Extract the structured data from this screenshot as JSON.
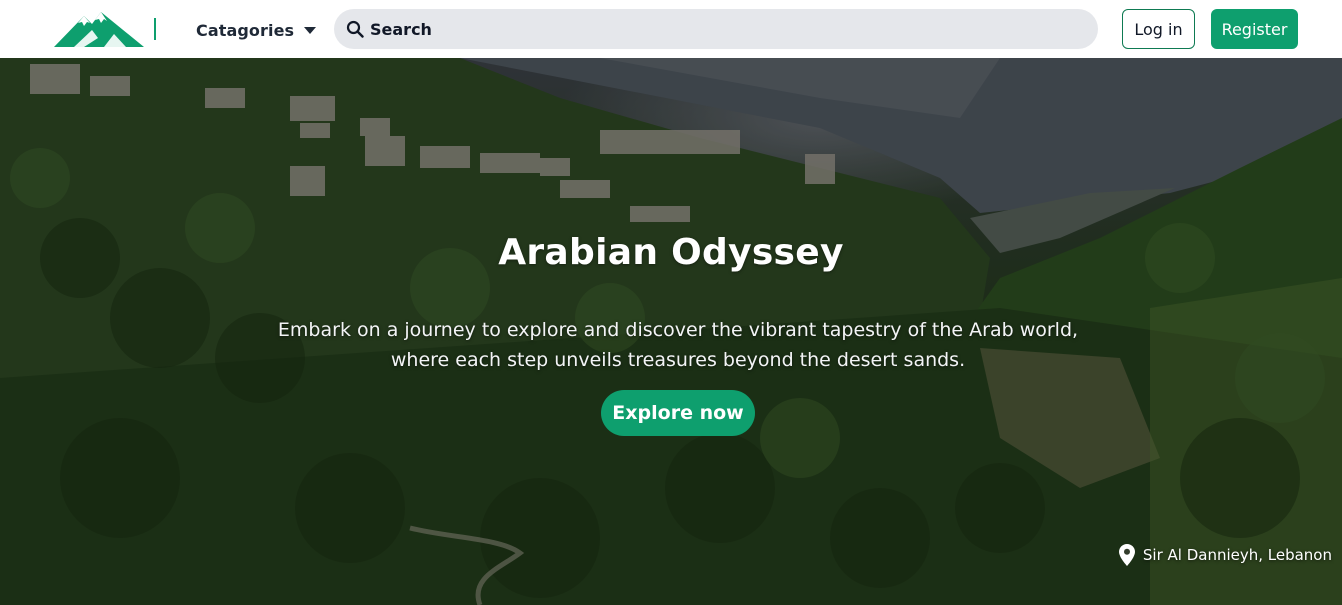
{
  "header": {
    "categories_label": "Catagories",
    "search_placeholder": "Search",
    "login_label": "Log in",
    "register_label": "Register"
  },
  "hero": {
    "title": "Arabian Odyssey",
    "description": "Embark on a journey to explore and discover the vibrant tapestry of the Arab world, where each step unveils treasures beyond the desert sands.",
    "cta_label": "Explore now",
    "location": "Sir Al Dannieyh, Lebanon"
  },
  "icons": {
    "logo": "mountain-logo-icon",
    "categories": "caret-down-icon",
    "search": "search-icon",
    "location": "map-pin-icon"
  },
  "colors": {
    "brand_green": "#0e9f6e",
    "search_bg": "#e5e7eb",
    "text_dark": "#1f2937"
  }
}
